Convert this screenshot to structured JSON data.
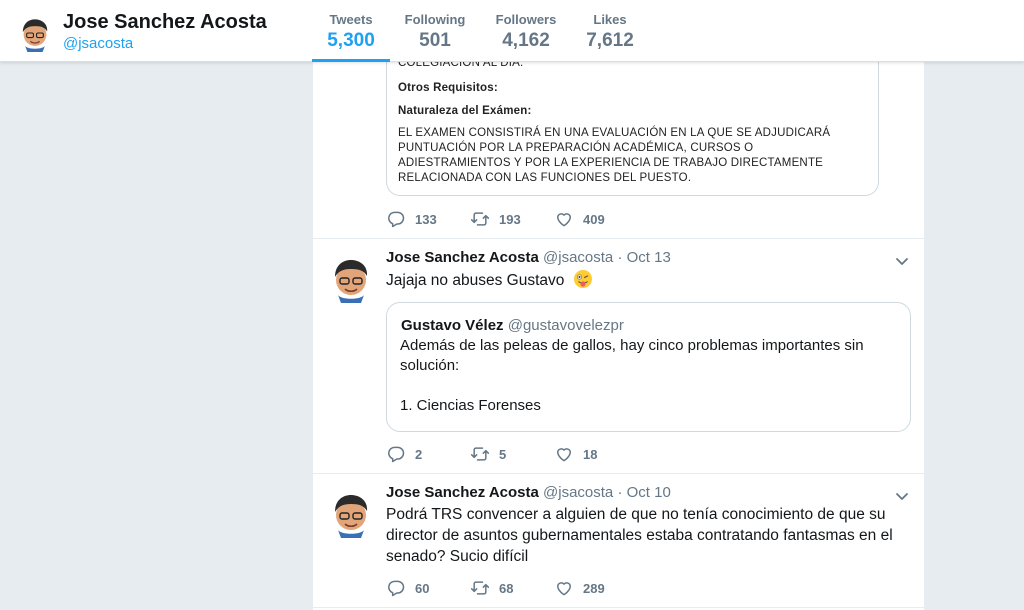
{
  "profile": {
    "name": "Jose Sanchez Acosta",
    "handle": "@jsacosta"
  },
  "stats": [
    {
      "label": "Tweets",
      "value": "5,300"
    },
    {
      "label": "Following",
      "value": "501"
    },
    {
      "label": "Followers",
      "value": "4,162"
    },
    {
      "label": "Likes",
      "value": "7,612"
    }
  ],
  "tweets": [
    {
      "document_image": {
        "lines": [
          {
            "text": "COLEGIACIÓN AL DÍA.",
            "bold": false
          },
          {
            "text": "Otros Requisitos:",
            "bold": true
          },
          {
            "text": "Naturaleza del Exámen:",
            "bold": true
          },
          {
            "text": "EL EXAMEN CONSISTIRÁ EN UNA EVALUACIÓN EN LA QUE SE ADJUDICARÁ",
            "bold": false
          },
          {
            "text": "PUNTUACIÓN POR LA PREPARACIÓN ACADÉMICA, CURSOS O",
            "bold": false
          },
          {
            "text": "ADIESTRAMIENTOS Y POR LA EXPERIENCIA DE TRABAJO DIRECTAMENTE",
            "bold": false
          },
          {
            "text": "RELACIONADA CON LAS FUNCIONES DEL PUESTO.",
            "bold": false
          }
        ]
      },
      "replies": "133",
      "retweets": "193",
      "likes": "409"
    },
    {
      "name": "Jose Sanchez Acosta",
      "handle": "@jsacosta",
      "date": "Oct 13",
      "text": "Jajaja no abuses Gustavo",
      "emoji": "winking-face-with-tongue",
      "quote": {
        "name": "Gustavo Vélez",
        "handle": "@gustavovelezpr",
        "text": "Además de las peleas de gallos, hay cinco problemas importantes sin solución:\n\n1. Ciencias Forenses"
      },
      "replies": "2",
      "retweets": "5",
      "likes": "18"
    },
    {
      "name": "Jose Sanchez Acosta",
      "handle": "@jsacosta",
      "date": "Oct 10",
      "text": "Podrá TRS convencer a alguien de que no tenía conocimiento de que su director de asuntos gubernamentales estaba contratando fantasmas en el senado? Sucio difícil",
      "replies": "60",
      "retweets": "68",
      "likes": "289"
    }
  ],
  "colors": {
    "accent": "#1da1f2",
    "muted": "#657786",
    "background": "#e6ecf0"
  },
  "icons": {
    "reply": "reply-icon",
    "retweet": "retweet-icon",
    "like": "heart-icon",
    "caret": "chevron-down-icon"
  }
}
